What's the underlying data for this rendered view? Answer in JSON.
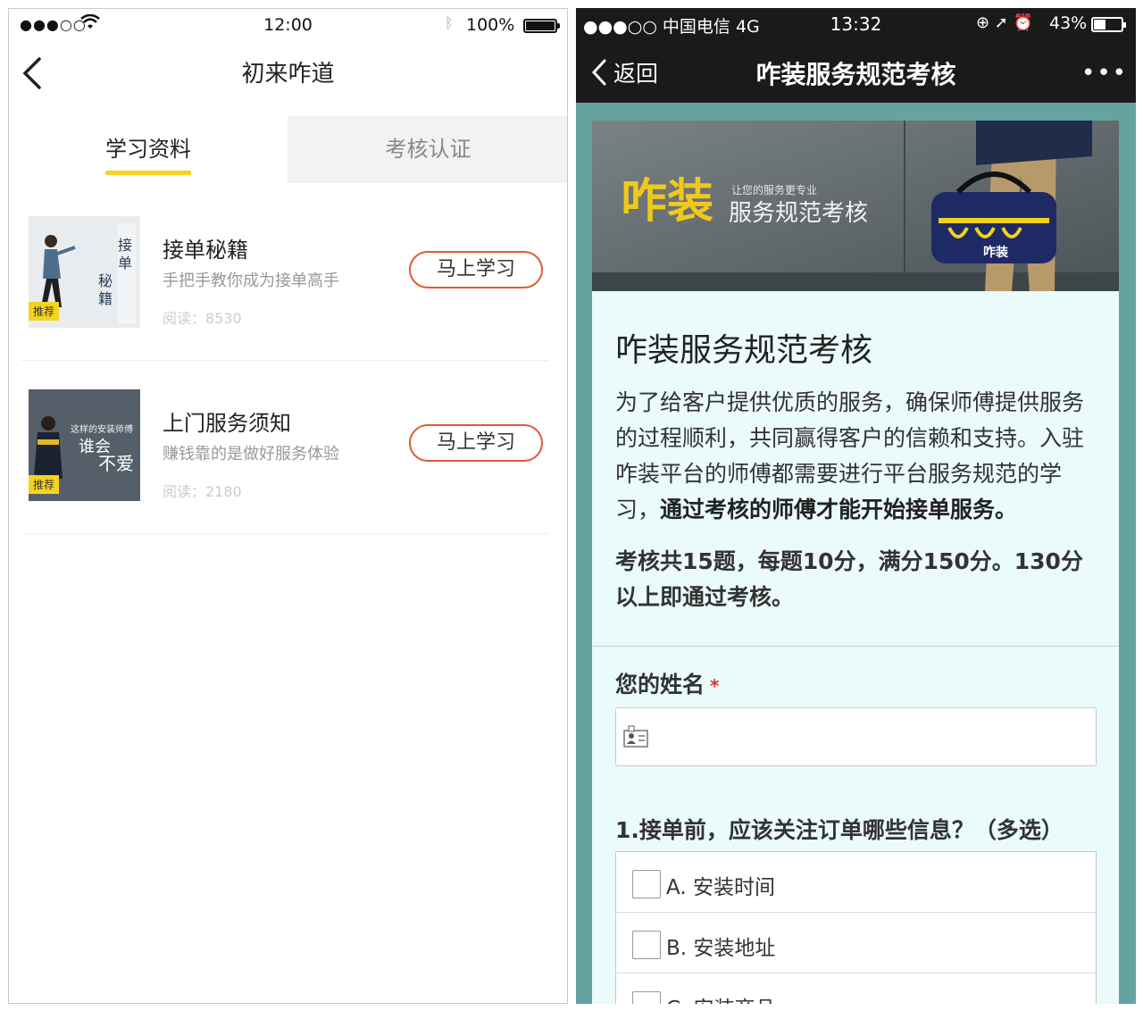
{
  "left_phone": {
    "status_bar": {
      "signal": "●●●○○",
      "time": "12:00",
      "battery_pct": "100%",
      "battery_level": 1.0
    },
    "nav": {
      "title": "初来咋道"
    },
    "tabs": [
      {
        "label": "学习资料",
        "active": true
      },
      {
        "label": "考核认证",
        "active": false
      }
    ],
    "items": [
      {
        "title": "接单秘籍",
        "desc": "手把手教你成为接单高手",
        "reads": "阅读：8530",
        "tag": "推荐",
        "button": "马上学习",
        "thumb_text": "接单秘籍"
      },
      {
        "title": "上门服务须知",
        "desc": "赚钱靠的是做好服务体验",
        "reads": "阅读：2180",
        "tag": "推荐",
        "button": "马上学习",
        "thumb_text_1": "这样的安装师傅",
        "thumb_text_2": "谁会",
        "thumb_text_3": "不爱"
      }
    ]
  },
  "right_phone": {
    "status_bar": {
      "carrier": "●●●○○ 中国电信  4G",
      "time": "13:32",
      "icons": "⊕ ➚ ⏰",
      "battery_pct": "43%",
      "battery_level": 0.43
    },
    "nav": {
      "back_label": "返回",
      "title": "咋装服务规范考核",
      "more": "•••"
    },
    "banner": {
      "brand": "咋装",
      "tagline": "让您的服务更专业",
      "subtitle": "服务规范考核",
      "bag_logo": "咋装"
    },
    "form": {
      "title": "咋装服务规范考核",
      "intro_plain": "为了给客户提供优质的服务，确保师傅提供服务的过程顺利，共同赢得客户的信赖和支持。入驻咋装平台的师傅都需要进行平台服务规范的学习，",
      "intro_bold": "通过考核的师傅才能开始接单服务。",
      "rules": "考核共15题，每题10分，满分150分。130分以上即通过考核。",
      "name_label": "您的姓名",
      "required_mark": "*",
      "question1": "1.接单前，应该关注订单哪些信息？（多选）",
      "options": [
        "A. 安装时间",
        "B. 安装地址",
        "C. 安装商品"
      ]
    }
  },
  "colors": {
    "accent_yellow": "#f5d320",
    "button_border": "#e25b35",
    "teal_bg": "#64a3a0",
    "required_red": "#e0332a"
  }
}
